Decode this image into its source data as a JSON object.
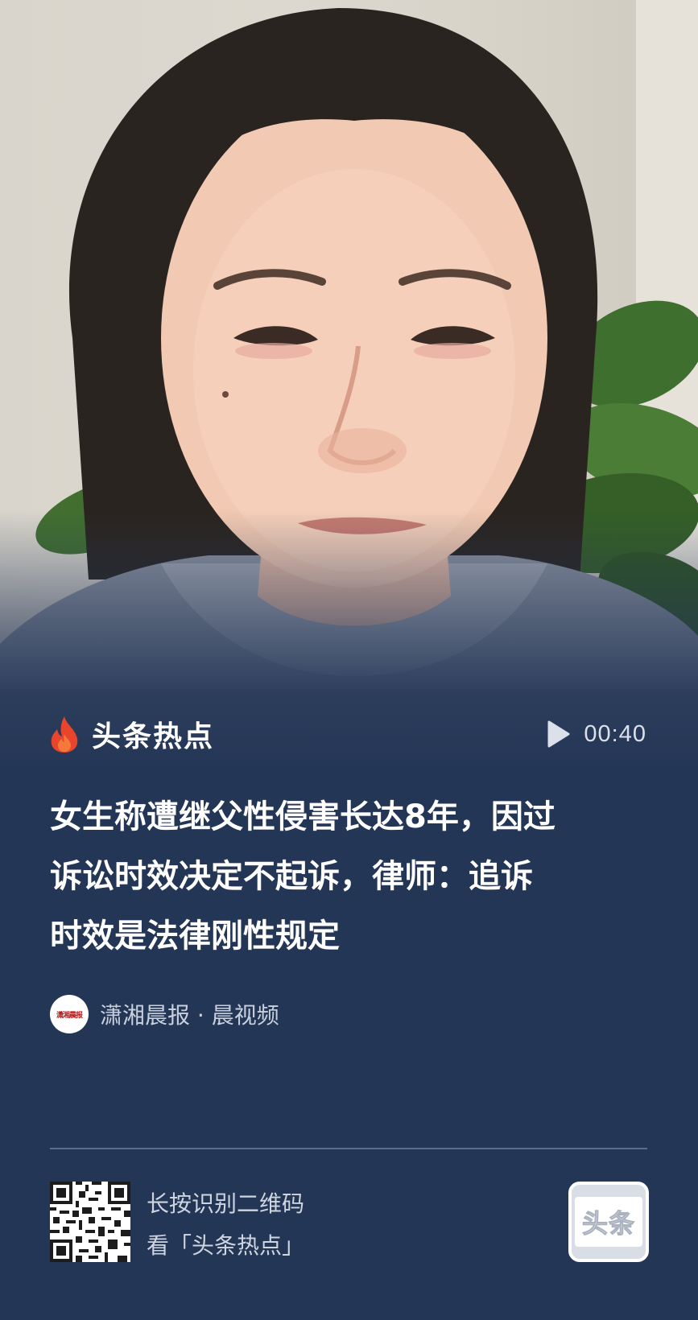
{
  "brand": {
    "title": "头条热点",
    "icon": "flame-icon"
  },
  "video": {
    "duration": "00:40",
    "icon": "play-icon"
  },
  "headline": {
    "line1": "女生称遭继父性侵害长达8年，因过",
    "line2": "诉讼时效决定不起诉，律师：追诉",
    "line3": "时效是法律刚性规定"
  },
  "source": {
    "avatar_text": "潇湘晨报",
    "label": "潇湘晨报 · 晨视频"
  },
  "footer": {
    "qr_hint_line1": "长按识别二维码",
    "qr_hint_line2": "看「头条热点」",
    "app_logo_text": "头条"
  },
  "colors": {
    "background": "#243656",
    "flame": "#e8452c",
    "text_primary": "#ffffff",
    "text_secondary": "#c9d0dd"
  }
}
